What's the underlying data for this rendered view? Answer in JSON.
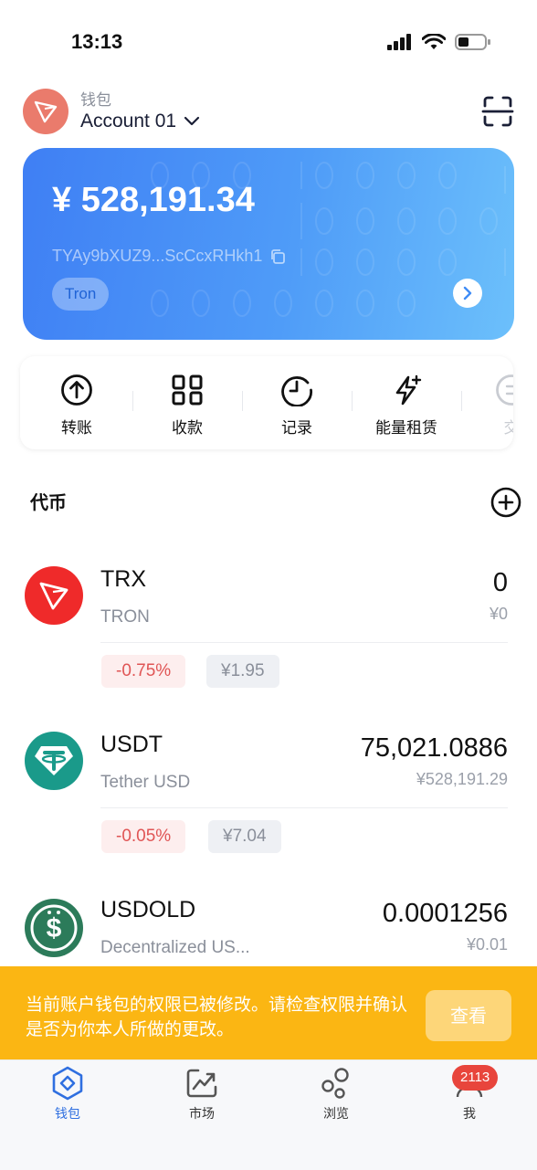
{
  "status_bar": {
    "time": "13:13"
  },
  "header": {
    "wallet_label": "钱包",
    "account_name": "Account 01"
  },
  "balance_card": {
    "balance": "¥ 528,191.34",
    "address": "TYAy9bXUZ9...ScCcxRHkh1",
    "chain": "Tron"
  },
  "actions": [
    {
      "label": "转账",
      "icon": "transfer-icon"
    },
    {
      "label": "收款",
      "icon": "qr-icon"
    },
    {
      "label": "记录",
      "icon": "clock-icon"
    },
    {
      "label": "能量租赁",
      "icon": "energy-icon"
    },
    {
      "label": "交",
      "icon": "exchange-icon"
    }
  ],
  "tokens": {
    "title": "代币",
    "items": [
      {
        "symbol": "TRX",
        "name": "TRON",
        "amount": "0",
        "value": "¥0",
        "change": "-0.75%",
        "price": "¥1.95"
      },
      {
        "symbol": "USDT",
        "name": "Tether USD",
        "amount": "75,021.0886",
        "value": "¥528,191.29",
        "change": "-0.05%",
        "price": "¥7.04"
      },
      {
        "symbol": "USDOLD",
        "name": "Decentralized US...",
        "amount": "0.0001256",
        "value": "¥0.01"
      }
    ]
  },
  "banner": {
    "text": "当前账户钱包的权限已被修改。请检查权限并确认是否为你本人所做的更改。",
    "button": "查看"
  },
  "tabbar": {
    "items": [
      {
        "label": "钱包",
        "icon": "wallet-icon",
        "active": true
      },
      {
        "label": "市场",
        "icon": "market-icon"
      },
      {
        "label": "浏览",
        "icon": "browse-icon"
      },
      {
        "label": "我",
        "icon": "profile-icon"
      }
    ],
    "badge": "2113"
  },
  "colors": {
    "accent": "#2f6fe0",
    "card_start": "#3f7ff4",
    "card_end": "#6cc0fb",
    "banner": "#fbb613",
    "negative": "#e05555",
    "trx_red": "#ef2a2a",
    "usdt_teal": "#1a9a8a",
    "usdold_green": "#2c7b5a"
  }
}
